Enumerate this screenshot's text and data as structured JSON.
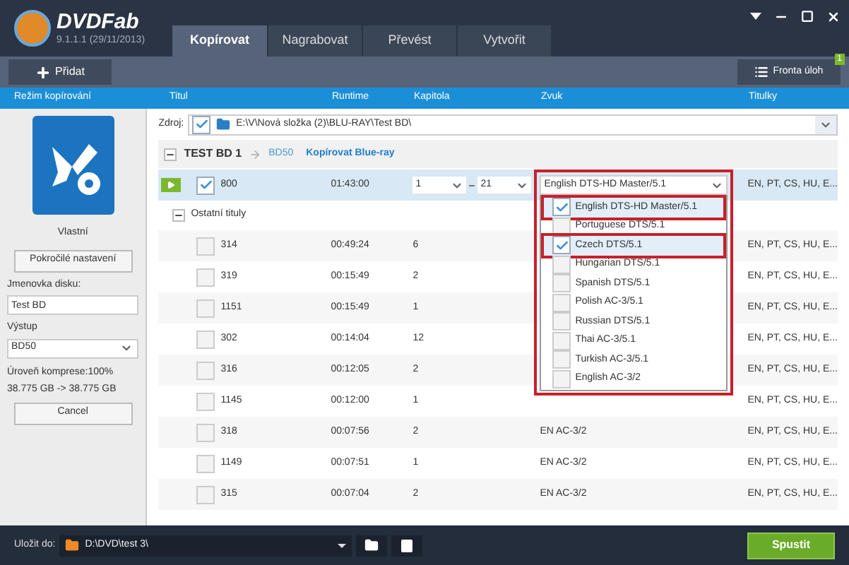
{
  "app": {
    "name": "DVDFab",
    "version": "9.1.1.1 (29/11/2013)"
  },
  "tabs": [
    {
      "label": "Kopírovat",
      "selected": true
    },
    {
      "label": "Nagrabovat",
      "selected": false
    },
    {
      "label": "Převést",
      "selected": false
    },
    {
      "label": "Vytvořit",
      "selected": false
    }
  ],
  "toolbar": {
    "add_button": "Přidat",
    "queue_button": "Fronta úloh",
    "queue_badge": "1"
  },
  "columns": [
    "Režim kopírování",
    "Titul",
    "Runtime",
    "Kapitola",
    "Zvuk",
    "Titulky"
  ],
  "left_panel": {
    "mode_label": "Vlastní",
    "advanced_button": "Pokročilé nastavení",
    "disc_label_caption": "Jmenovka disku:",
    "disc_label_value": "Test BD",
    "output_caption": "Výstup",
    "output_value": "BD50",
    "compression": "Úroveň komprese:100%",
    "size": "38.775 GB -> 38.775 GB",
    "cancel_button": "Cancel"
  },
  "source": {
    "label": "Zdroj:",
    "checked": true,
    "path": "E:\\V\\Nová složka (2)\\BLU-RAY\\Test BD\\"
  },
  "disc": {
    "name": "TEST BD 1",
    "format": "BD50",
    "mode": "Kopírovat Blue-ray",
    "expanded": true
  },
  "main_title": {
    "title": "800",
    "checked": true,
    "runtime": "01:43:00",
    "chapter_from": "1",
    "chapter_to": "21",
    "audio": "English DTS-HD Master/5.1",
    "subtitles": "EN, PT, CS, HU, E..."
  },
  "audio_dropdown": [
    {
      "label": "English DTS-HD Master/5.1",
      "checked": true
    },
    {
      "label": "Portuguese DTS/5.1",
      "checked": false
    },
    {
      "label": "Czech DTS/5.1",
      "checked": true
    },
    {
      "label": "Hungarian DTS/5.1",
      "checked": false
    },
    {
      "label": "Spanish DTS/5.1",
      "checked": false
    },
    {
      "label": "Polish AC-3/5.1",
      "checked": false
    },
    {
      "label": "Russian DTS/5.1",
      "checked": false
    },
    {
      "label": "Thai AC-3/5.1",
      "checked": false
    },
    {
      "label": "Turkish AC-3/5.1",
      "checked": false
    },
    {
      "label": "English AC-3/2",
      "checked": false
    }
  ],
  "other_titles": {
    "label": "Ostatní tituly",
    "expanded": true,
    "rows": [
      {
        "title": "314",
        "checked": false,
        "runtime": "00:49:24",
        "chapters": "6",
        "subtitles": "EN, PT, CS, HU, E..."
      },
      {
        "title": "319",
        "checked": false,
        "runtime": "00:15:49",
        "chapters": "2",
        "subtitles": "EN, PT, CS, HU, E..."
      },
      {
        "title": "1151",
        "checked": false,
        "runtime": "00:15:49",
        "chapters": "1",
        "subtitles": "EN, PT, CS, HU, E..."
      },
      {
        "title": "302",
        "checked": false,
        "runtime": "00:14:04",
        "chapters": "12",
        "subtitles": "EN, PT, CS, HU, E..."
      },
      {
        "title": "316",
        "checked": false,
        "runtime": "00:12:05",
        "chapters": "2",
        "subtitles": "EN, PT, CS, HU, E..."
      },
      {
        "title": "1145",
        "checked": false,
        "runtime": "00:12:00",
        "chapters": "1",
        "subtitles": "EN, PT, CS, HU, E..."
      },
      {
        "title": "318",
        "checked": false,
        "runtime": "00:07:56",
        "chapters": "2",
        "audio": "EN AC-3/2",
        "subtitles": "EN, PT, CS, HU, E..."
      },
      {
        "title": "1149",
        "checked": false,
        "runtime": "00:07:51",
        "chapters": "1",
        "audio": "EN AC-3/2",
        "subtitles": "EN, PT, CS, HU, E..."
      },
      {
        "title": "315",
        "checked": false,
        "runtime": "00:07:04",
        "chapters": "2",
        "audio": "EN AC-3/2",
        "subtitles": "EN, PT, CS, HU, E..."
      }
    ]
  },
  "save": {
    "label": "Uložit do:",
    "path": "D:\\DVD\\test 3\\"
  },
  "start_button": "Spustit"
}
